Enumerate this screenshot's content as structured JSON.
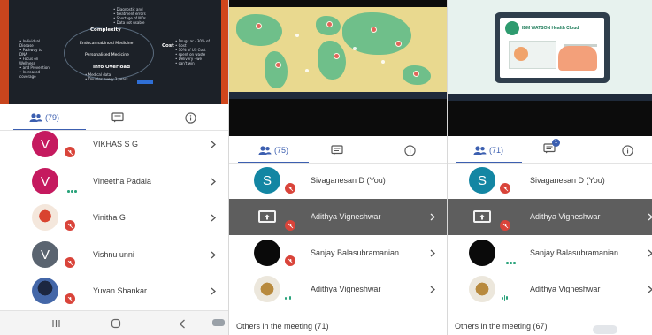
{
  "colors": {
    "accent": "#3c5fb0",
    "mic_off": "#d9443a",
    "speaking": "#2aa37b"
  },
  "panels": [
    {
      "id": "panel-1",
      "slide": {
        "kind": "concept-map",
        "center": "Complexity",
        "nodes": [
          "Endocannabinoid Medicine",
          "Personalised Medicine",
          "Info Overload",
          "Cost"
        ]
      },
      "tabs": {
        "participants_count": "(79)"
      },
      "participants": [
        {
          "initial": "V",
          "name": "VIKHAS S G"
        },
        {
          "initial": "V",
          "name": "Vineetha Padala"
        },
        {
          "initial": "",
          "name": "Vinitha G"
        },
        {
          "initial": "V",
          "name": "Vishnu unni"
        },
        {
          "initial": "",
          "name": "Yuvan Shankar"
        }
      ],
      "nav": {
        "recents": "|||",
        "home": "○",
        "back": "<"
      }
    },
    {
      "id": "panel-2",
      "slide": {
        "kind": "world-map"
      },
      "tabs": {
        "participants_count": "(75)"
      },
      "participants": [
        {
          "initial": "S",
          "name": "Sivaganesan D (You)"
        },
        {
          "initial": "",
          "name": "Adithya Vigneshwar"
        },
        {
          "initial": "",
          "name": "Sanjay Balasubramanian"
        },
        {
          "initial": "",
          "name": "Adithya Vigneshwar"
        }
      ],
      "footer": "Others in the meeting (71)"
    },
    {
      "id": "panel-3",
      "slide": {
        "kind": "ibm-watson",
        "title": "IBM WATSON Health Cloud"
      },
      "tabs": {
        "participants_count": "(71)",
        "chat_badge": "1"
      },
      "participants": [
        {
          "initial": "S",
          "name": "Sivaganesan D (You)"
        },
        {
          "initial": "",
          "name": "Adithya Vigneshwar"
        },
        {
          "initial": "",
          "name": "Sanjay Balasubramanian"
        },
        {
          "initial": "",
          "name": "Adithya Vigneshwar"
        }
      ],
      "footer": "Others in the meeting (67)"
    }
  ]
}
